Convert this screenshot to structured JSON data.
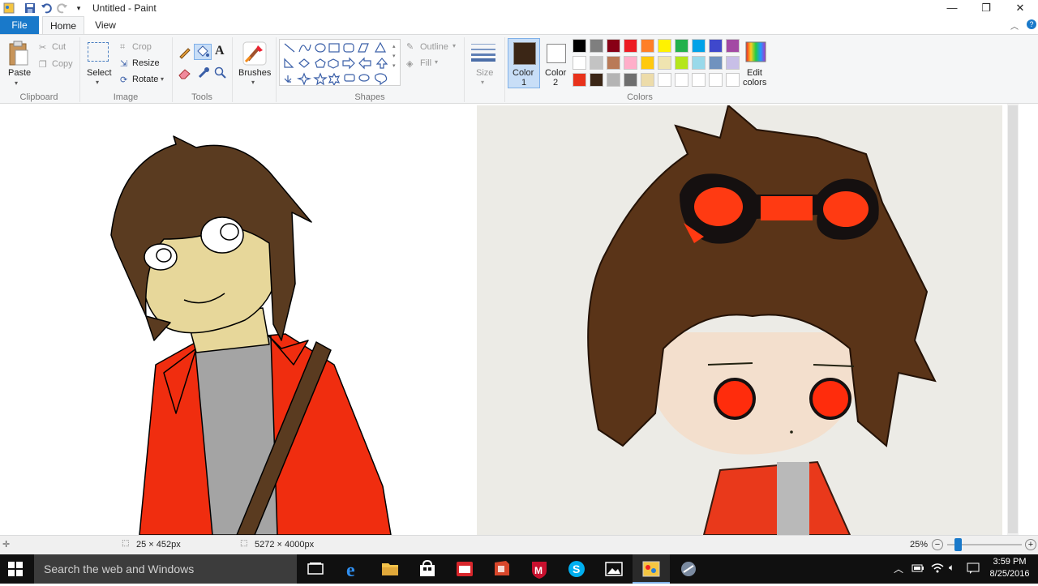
{
  "window": {
    "title": "Untitled - Paint",
    "minimize": "—",
    "maximize": "❐",
    "close": "✕"
  },
  "tabs": {
    "file": "File",
    "home": "Home",
    "view": "View"
  },
  "ribbon": {
    "clipboard": {
      "paste": "Paste",
      "cut": "Cut",
      "copy": "Copy",
      "group": "Clipboard"
    },
    "image": {
      "select": "Select",
      "crop": "Crop",
      "resize": "Resize",
      "rotate": "Rotate",
      "group": "Image"
    },
    "tools": {
      "group": "Tools"
    },
    "brushes": {
      "label": "Brushes"
    },
    "shapes": {
      "outline": "Outline",
      "fill": "Fill",
      "group": "Shapes"
    },
    "size": {
      "label": "Size"
    },
    "color1": {
      "label1": "Color",
      "label2": "1"
    },
    "color2": {
      "label1": "Color",
      "label2": "2"
    },
    "colors": {
      "group": "Colors",
      "edit1": "Edit",
      "edit2": "colors"
    },
    "palette": {
      "row1": [
        "#000000",
        "#7f7f7f",
        "#880015",
        "#ed1c24",
        "#ff7f27",
        "#fff200",
        "#22b14c",
        "#00a2e8",
        "#3f48cc",
        "#a349a4"
      ],
      "row2": [
        "#ffffff",
        "#c3c3c3",
        "#b97a57",
        "#ffaec9",
        "#ffc90e",
        "#efe4b0",
        "#b5e61d",
        "#99d9ea",
        "#7092be",
        "#c8bfe7"
      ],
      "row3": [
        "#e8321b",
        "#3b2616",
        "#b4b4b4",
        "#6e6e6e",
        "#eddcaa",
        "#ffffff",
        "#ffffff",
        "#ffffff",
        "#ffffff",
        "#ffffff"
      ]
    },
    "color1_value": "#3b2616",
    "color2_value": "#ffffff"
  },
  "status": {
    "selection_size": "25 × 452px",
    "image_size": "5272 × 4000px",
    "zoom": "25%"
  },
  "taskbar": {
    "search_placeholder": "Search the web and Windows",
    "time": "3:59 PM",
    "date": "8/25/2016"
  }
}
